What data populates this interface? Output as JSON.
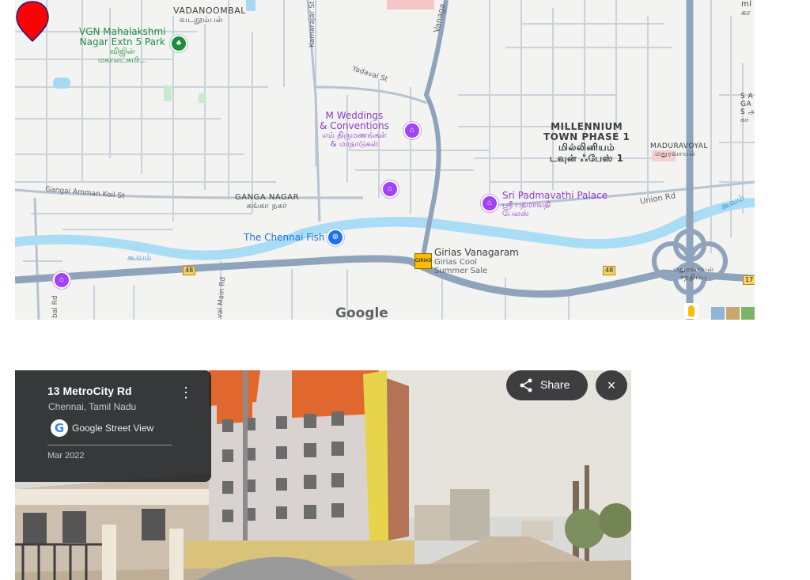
{
  "map": {
    "labels": {
      "vadanoombal_en": "VADANOOMBAL",
      "vadanoombal_ta": "வடநூம்பல்",
      "vgn_park_en1": "VGN Mahalakshmi",
      "vgn_park_en2": "Nagar Extn 5 Park",
      "vgn_park_ta1": "விஜின்",
      "vgn_park_ta2": "மகாலட்சுமி...",
      "kamarajar_st": "Kamarajar St",
      "yadaval_st": "Yadaval St",
      "vanagaram": "Vanaga",
      "m_weddings_1": "M Weddings",
      "m_weddings_2": "& Conventions",
      "m_weddings_ta1": "எம் திருமணங்கள்",
      "m_weddings_ta2": "& மாநாடுகள்",
      "millennium_1": "MILLENNIUM",
      "millennium_2": "TOWN PHASE 1",
      "millennium_ta1": "மில்லினியம்",
      "millennium_ta2": "டவுன் ஃபேஸ் 1",
      "maduravoyal_en": "MADURAVOYAL",
      "maduravoyal_ta": "மதுரவாயல்",
      "sa_1": "S A",
      "sa_2": "GA",
      "sa_3": "S அ",
      "sa_4": "கா",
      "top_right_1": "ml",
      "top_right_2": "கா",
      "gangai_amman": "Gangai Amman Koil St",
      "ganga_nagar_en": "GANGA NAGAR",
      "ganga_nagar_ta": "கங்கா நகர்",
      "padmavathi_1": "Sri Padmavathi Palace",
      "padmavathi_ta1": "ஸ்ரீ பத்மாவதி",
      "padmavathi_ta2": "பேலஸ்",
      "union_rd": "Union Rd",
      "chennai_fish": "The Chennai Fish",
      "river_left": "கூவம்",
      "river_right": "கூவம்",
      "girias_1": "Girias Vanagaram",
      "girias_2": "Girias Cool",
      "girias_3": "Summer Sale",
      "maduravoyal_jn_1": "மதுரவாயல்",
      "maduravoyal_jn_2": "சந்திப்பு",
      "shield_48": "48",
      "shield_17": "17",
      "bal_rd": "bal Rd",
      "main_rd": "Main Rd",
      "val_main_rd": "val Main Rd",
      "google": "Google"
    },
    "colors": {
      "road_major": "#9aa9bd",
      "road_minor": "#c2ccd8",
      "river": "#a9d8f2",
      "marker": "#ff0000",
      "poi": "#a142f4"
    }
  },
  "street_view": {
    "address": "13 MetroCity Rd",
    "city": "Chennai, Tamil Nadu",
    "source": "Google Street View",
    "date": "Mar 2022",
    "share_label": "Share",
    "close_icon": "×",
    "menu_icon": "⋮"
  }
}
